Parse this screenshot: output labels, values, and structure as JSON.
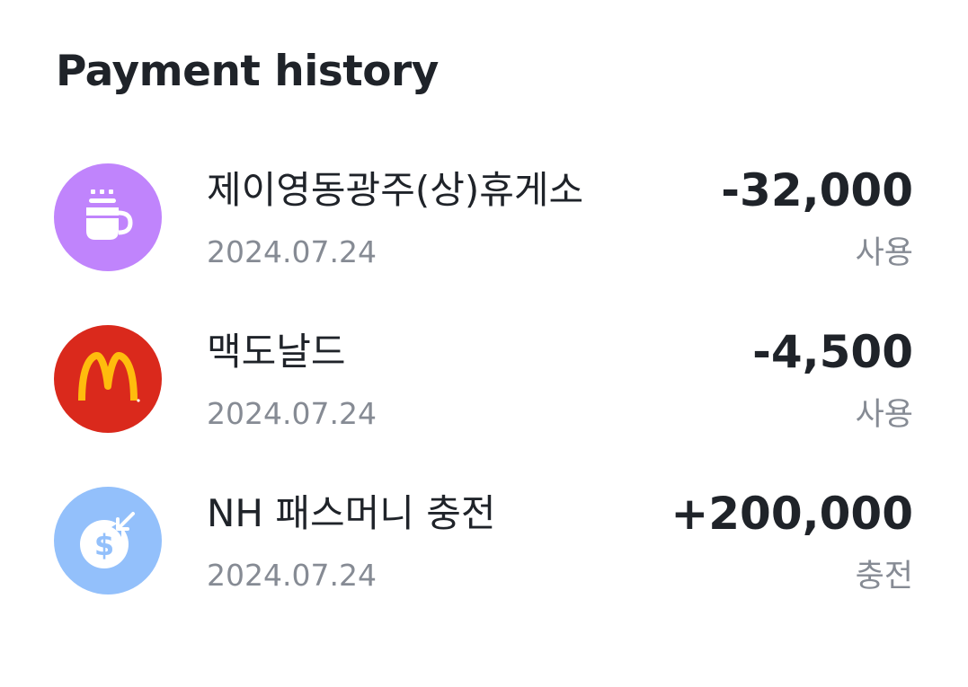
{
  "header": {
    "title": "Payment history"
  },
  "transactions": [
    {
      "merchant": "제이영동광주(상)휴게소",
      "date": "2024.07.24",
      "amount": "-32,000",
      "type": "사용",
      "icon": "coffee-cup-icon",
      "icon_bg": "#c084fc"
    },
    {
      "merchant": "맥도날드",
      "date": "2024.07.24",
      "amount": "-4,500",
      "type": "사용",
      "icon": "mcdonalds-logo-icon",
      "icon_bg": "#da291c"
    },
    {
      "merchant": "NH 패스머니 충전",
      "date": "2024.07.24",
      "amount": "+200,000",
      "type": "충전",
      "icon": "dollar-coin-icon",
      "icon_bg": "#93c0fb"
    }
  ]
}
